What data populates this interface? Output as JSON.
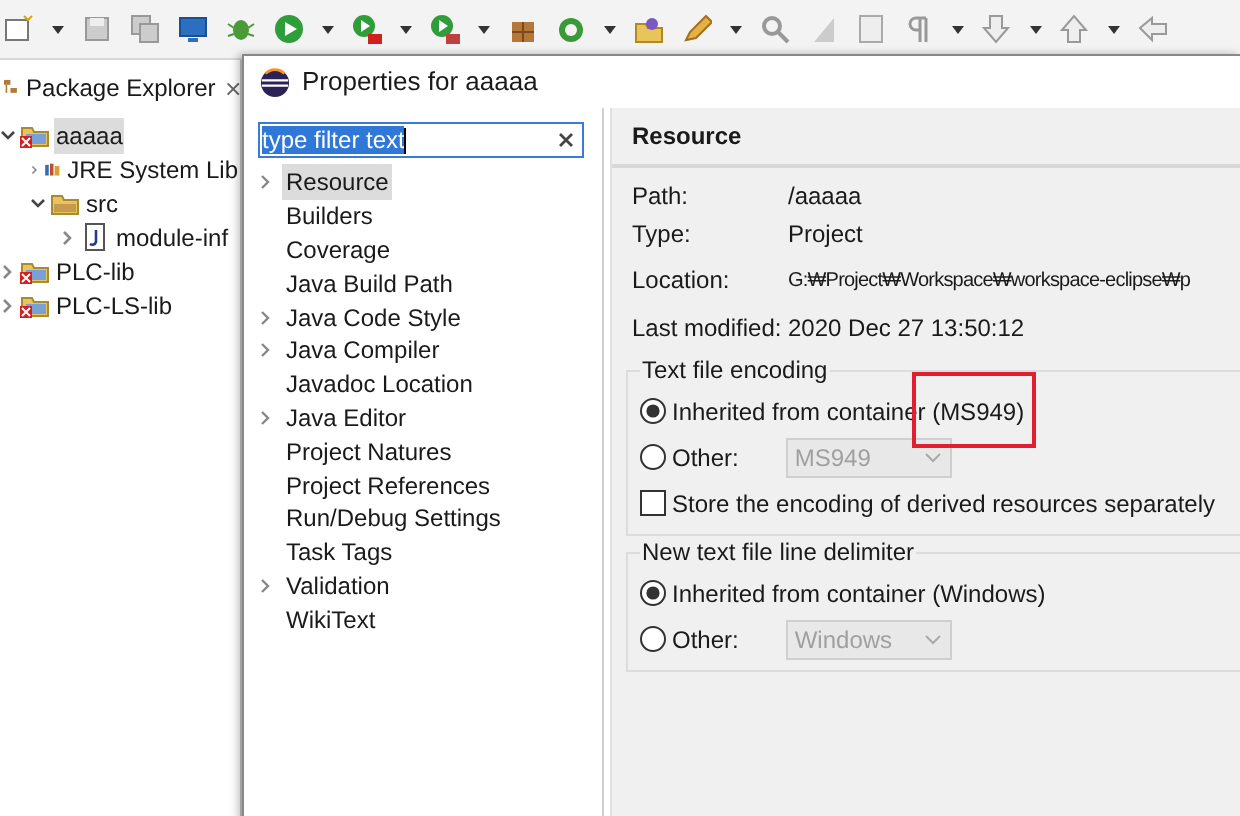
{
  "package_explorer": {
    "title": "Package Explorer",
    "tree": [
      {
        "label": "aaaaa",
        "kind": "project",
        "error": true,
        "expanded": true,
        "selected": true,
        "children": [
          {
            "label": "JRE System Lib",
            "kind": "library",
            "expanded": false,
            "selected": false
          },
          {
            "label": "src",
            "kind": "folder",
            "expanded": true,
            "selected": false,
            "children": [
              {
                "label": "module-inf",
                "kind": "file",
                "expanded": false,
                "selected": false
              }
            ]
          }
        ]
      },
      {
        "label": "PLC-lib",
        "kind": "project",
        "error": true,
        "expanded": false,
        "selected": false
      },
      {
        "label": "PLC-LS-lib",
        "kind": "project",
        "error": true,
        "expanded": false,
        "selected": false
      }
    ]
  },
  "dialog": {
    "title": "Properties for aaaaa",
    "filter": {
      "value": "type filter text"
    },
    "pages": [
      {
        "label": "Resource",
        "expandable": true,
        "selected": true
      },
      {
        "label": "Builders",
        "expandable": false,
        "selected": false
      },
      {
        "label": "Coverage",
        "expandable": false,
        "selected": false
      },
      {
        "label": "Java Build Path",
        "expandable": false,
        "selected": false
      },
      {
        "label": "Java Code Style",
        "expandable": true,
        "selected": false
      },
      {
        "label": "Java Compiler",
        "expandable": true,
        "selected": false
      },
      {
        "label": "Javadoc Location",
        "expandable": false,
        "selected": false
      },
      {
        "label": "Java Editor",
        "expandable": true,
        "selected": false
      },
      {
        "label": "Project Natures",
        "expandable": false,
        "selected": false
      },
      {
        "label": "Project References",
        "expandable": false,
        "selected": false
      },
      {
        "label": "Run/Debug Settings",
        "expandable": false,
        "selected": false
      },
      {
        "label": "Task Tags",
        "expandable": false,
        "selected": false
      },
      {
        "label": "Validation",
        "expandable": true,
        "selected": false
      },
      {
        "label": "WikiText",
        "expandable": false,
        "selected": false
      }
    ],
    "page_title": "Resource",
    "info": [
      {
        "label": "Path:",
        "value": "/aaaaa"
      },
      {
        "label": "Type:",
        "value": "Project"
      },
      {
        "label": "Location:",
        "value": "G:₩Project₩Workspace₩workspace-eclipse₩p"
      },
      {
        "label": "Last modified:",
        "value": "2020 Dec 27 13:50:12"
      }
    ],
    "groups": [
      {
        "title": "Text file encoding",
        "items": [
          {
            "kind": "radio",
            "label": "Inherited from container (MS949)",
            "selected": true,
            "highlighted": true
          },
          {
            "kind": "radio",
            "label": "Other:",
            "selected": false,
            "dropdown": "MS949"
          },
          {
            "kind": "checkbox",
            "label": "Store the encoding of derived resources separately",
            "checked": false
          }
        ]
      },
      {
        "title": "New text file line delimiter",
        "items": [
          {
            "kind": "radio",
            "label": "Inherited from container (Windows)",
            "selected": true
          },
          {
            "kind": "radio",
            "label": "Other:",
            "selected": false,
            "dropdown": "Windows"
          }
        ]
      }
    ]
  }
}
